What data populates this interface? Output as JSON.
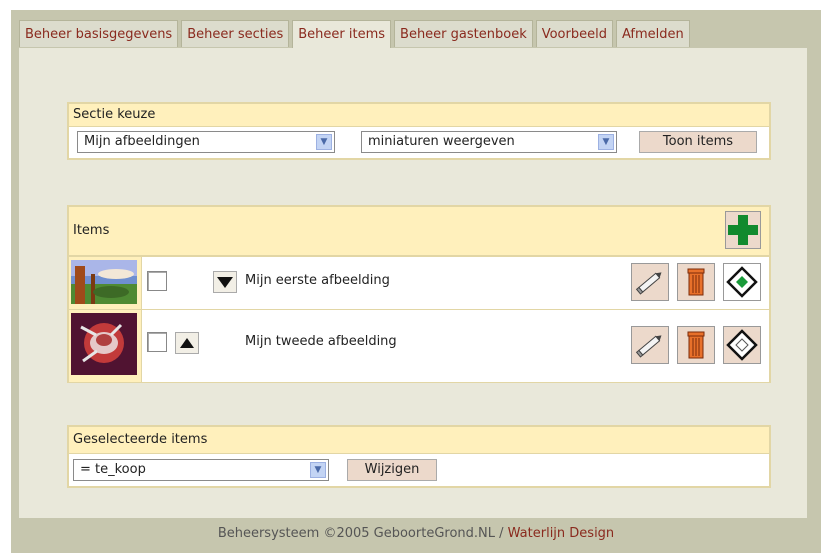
{
  "tabs": [
    {
      "label": "Beheer basisgegevens",
      "active": false
    },
    {
      "label": "Beheer secties",
      "active": false
    },
    {
      "label": "Beheer items",
      "active": true
    },
    {
      "label": "Beheer gastenboek",
      "active": false
    },
    {
      "label": "Voorbeeld",
      "active": false
    },
    {
      "label": "Afmelden",
      "active": false
    }
  ],
  "section_choice": {
    "title": "Sectie keuze",
    "section_select": "Mijn afbeeldingen",
    "view_select": "miniaturen weergeven",
    "show_button": "Toon items"
  },
  "items_panel": {
    "title": "Items",
    "rows": [
      {
        "title": "Mijn eerste afbeelding",
        "move": "down"
      },
      {
        "title": "Mijn tweede afbeelding",
        "move": "up"
      }
    ]
  },
  "selected": {
    "title": "Geselecteerde items",
    "select_value": "= te_koop",
    "button": "Wijzigen"
  },
  "footer": {
    "text": "Beheersysteem ©2005 GeboorteGrond.NL / ",
    "link": "Waterlijn Design"
  },
  "colors": {
    "frame": "#c6c6ae",
    "content": "#e9e8da",
    "panel_header": "#fff0bc",
    "tab_text": "#8a2a1e",
    "add_icon": "#118a2e"
  },
  "icons": [
    "add-icon",
    "down-arrow-icon",
    "up-arrow-icon",
    "pencil-icon",
    "trash-icon",
    "diamond-icon",
    "dropdown-arrow-icon"
  ]
}
